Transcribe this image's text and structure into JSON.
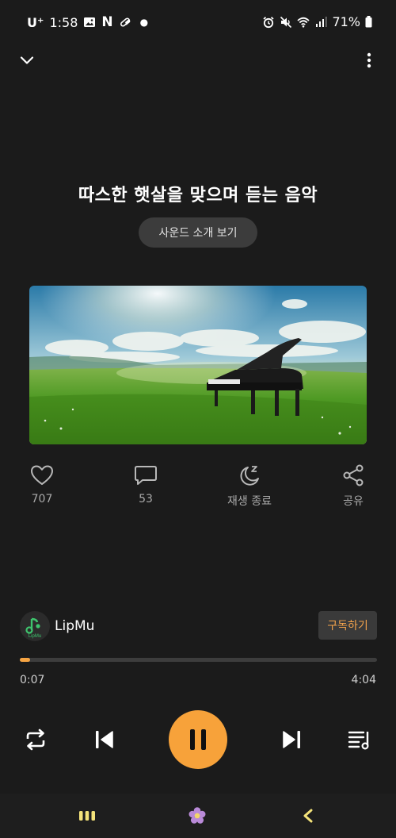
{
  "status_bar": {
    "carrier": "U⁺",
    "time": "1:58",
    "notification_icons": [
      "gallery-icon",
      "netflix-n-icon",
      "pill-icon",
      "dot-icon"
    ],
    "n_letter": "N",
    "battery": "71%"
  },
  "title": "따스한 햇살을 맞으며 듣는 음악",
  "intro_button": "사운드 소개 보기",
  "actions": {
    "like_count": "707",
    "comment_count": "53",
    "sleep_timer_label": "재생 종료",
    "share_label": "공유"
  },
  "channel": {
    "name": "LipMu",
    "avatar_text": "LipMu",
    "subscribe_label": "구독하기"
  },
  "playback": {
    "current_time": "0:07",
    "total_time": "4:04",
    "progress_fraction": 0.029,
    "state": "playing"
  },
  "colors": {
    "accent": "#f7a23a",
    "background": "#1b1b1b",
    "subscribe_text": "#f2a24b"
  },
  "icons": {
    "top_left": "chevron-down-icon",
    "top_right": "more-vertical-icon",
    "controls": [
      "repeat-icon",
      "skip-previous-icon",
      "pause-icon",
      "skip-next-icon",
      "playlist-icon"
    ],
    "nav": [
      "recent-apps-icon",
      "flower-home-icon",
      "back-icon"
    ]
  }
}
